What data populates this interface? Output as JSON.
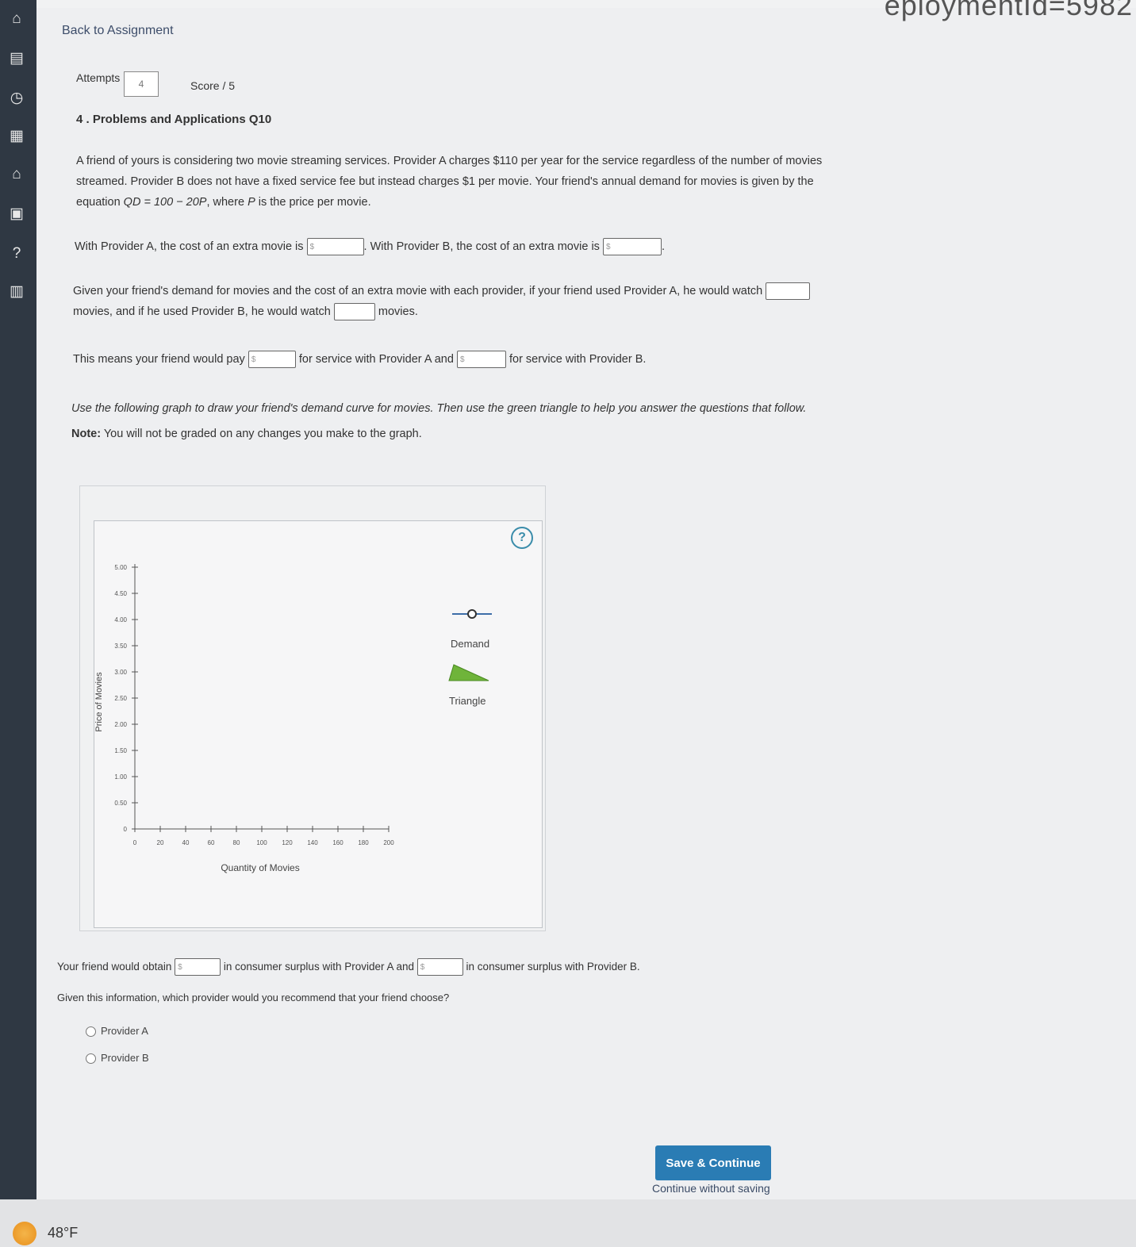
{
  "url_fragment": "eploymentId=5982",
  "sidebar": {
    "icons": [
      "home-icon",
      "book-icon",
      "clock-icon",
      "notebook-icon",
      "graduation-cap-icon",
      "calendar-icon",
      "help-icon",
      "reader-icon"
    ]
  },
  "header": {
    "back_link": "Back to Assignment",
    "attempts_label": "Attempts",
    "attempts_value": "4",
    "score_label": "Score / 5"
  },
  "question": {
    "title": "4 . Problems and Applications Q10",
    "intro_part1": "A friend of yours is considering two movie streaming services. Provider A charges $110 per year for the service regardless of the number of movies streamed. Provider B does not have a fixed service fee but instead charges $1 per movie. Your friend's annual demand for movies is given by the equation ",
    "intro_equation": "QD = 100 − 20P",
    "intro_part2": ", where ",
    "intro_p": "P",
    "intro_part3": " is the price per movie.",
    "q1_a": "With Provider A, the cost of an extra movie is",
    "q1_b": ". With Provider B, the cost of an extra movie is",
    "q1_c": ".",
    "q2_a": "Given your friend's demand for movies and the cost of an extra movie with each provider, if your friend used Provider A, he would watch",
    "q2_b": "movies, and if he used Provider B, he would watch",
    "q2_c": "movies.",
    "q3_a": "This means your friend would pay",
    "q3_b": "for service with Provider A and",
    "q3_c": "for service with Provider B.",
    "instruction": "Use the following graph to draw your friend's demand curve for movies. Then use the green triangle to help you answer the questions that follow.",
    "note_label": "Note:",
    "note_text": " You will not be graded on any changes you make to the graph.",
    "dollar_placeholder": "$",
    "cs_a": "Your friend would obtain",
    "cs_b": "in consumer surplus with Provider A and",
    "cs_c": "in consumer surplus with Provider B.",
    "recommend_q": "Given this information, which provider would you recommend that your friend choose?",
    "options": [
      "Provider A",
      "Provider B"
    ]
  },
  "graph": {
    "help": "?",
    "legend_demand": "Demand",
    "legend_triangle": "Triangle",
    "colors": {
      "demand_line": "#3d6ea8",
      "triangle": "#6fb43a"
    }
  },
  "chart_data": {
    "type": "line",
    "title": "",
    "xlabel": "Quantity of Movies",
    "ylabel": "Price of Movies",
    "xlim": [
      0,
      200
    ],
    "ylim": [
      0,
      5
    ],
    "xticks": [
      "0",
      "20",
      "40",
      "60",
      "80",
      "100",
      "120",
      "140",
      "160",
      "180",
      "200"
    ],
    "yticks": [
      "0",
      "0.50",
      "1.00",
      "1.50",
      "2.00",
      "2.50",
      "3.00",
      "3.50",
      "4.00",
      "4.50",
      "5.00"
    ],
    "series": []
  },
  "footer": {
    "save_button": "Save & Continue",
    "continue_link": "Continue without saving",
    "temperature": "48°F"
  }
}
